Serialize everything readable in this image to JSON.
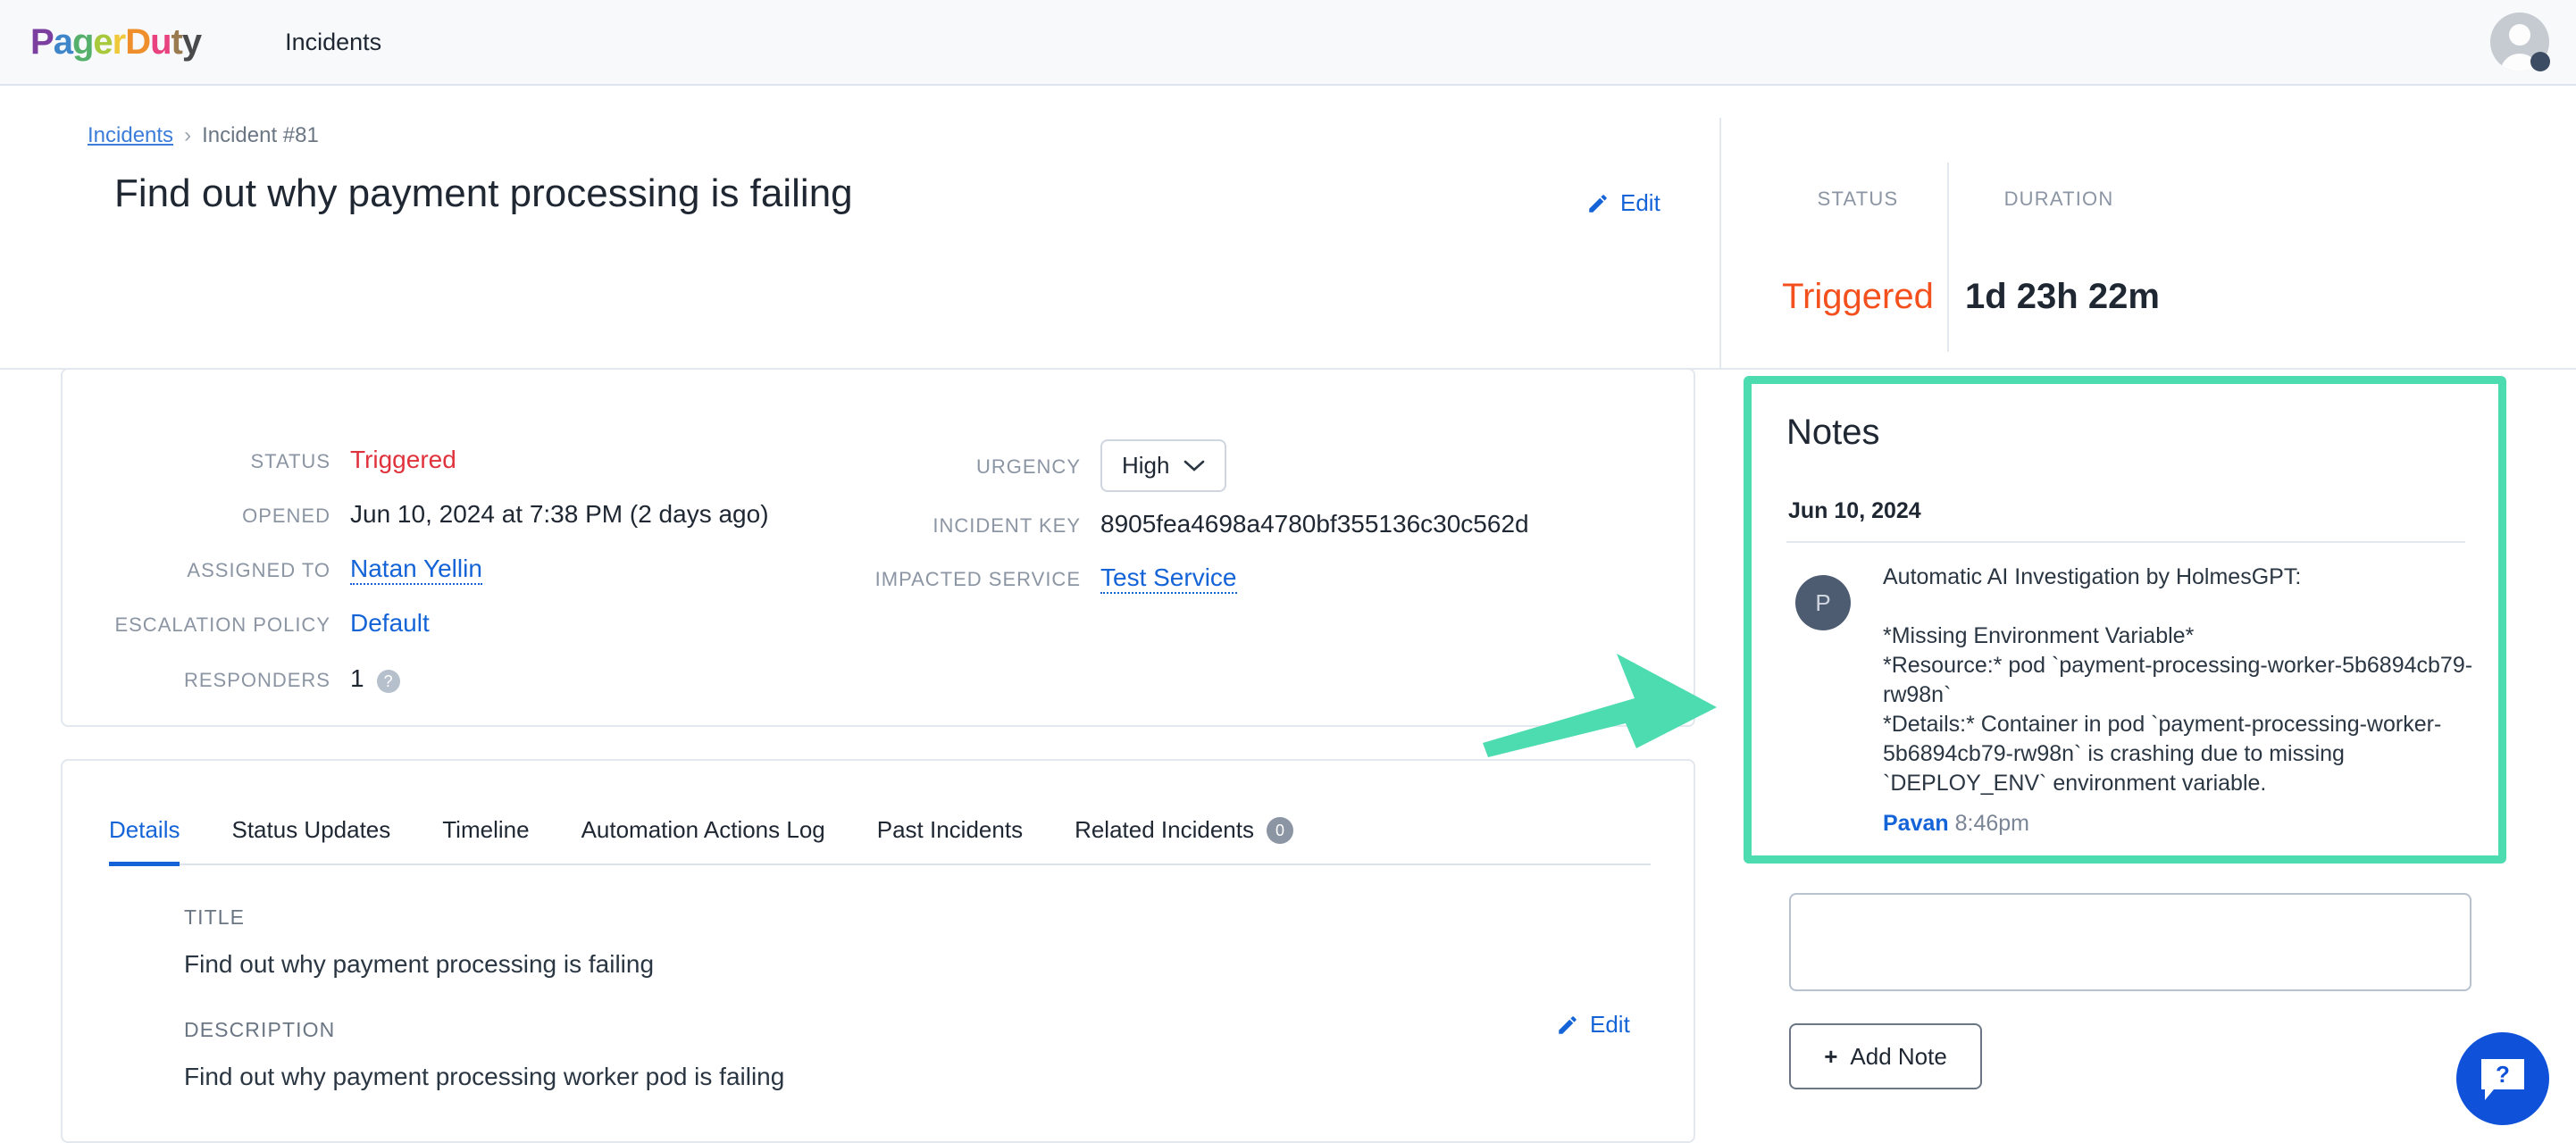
{
  "nav": {
    "brand": [
      {
        "ch": "P",
        "color": "#7b3fa0"
      },
      {
        "ch": "a",
        "color": "#3e86c9"
      },
      {
        "ch": "g",
        "color": "#54b06a"
      },
      {
        "ch": "e",
        "color": "#a8c93c"
      },
      {
        "ch": "r",
        "color": "#efc93a"
      },
      {
        "ch": "D",
        "color": "#ef8f2c"
      },
      {
        "ch": "u",
        "color": "#e8437e"
      },
      {
        "ch": "t",
        "color": "#9a7b4f"
      },
      {
        "ch": "y",
        "color": "#4a4a4a"
      }
    ],
    "brand_text": "PagerDuty",
    "incidents_link": "Incidents",
    "avatar_name": "user-avatar"
  },
  "breadcrumb": {
    "root": "Incidents",
    "separator": "›",
    "current": "Incident #81"
  },
  "header": {
    "title": "Find out why payment processing is failing",
    "edit_label": "Edit",
    "status_label": "STATUS",
    "status_value": "Triggered",
    "duration_label": "DURATION",
    "duration_value": "1d 23h 22m"
  },
  "details_card": {
    "status_label": "STATUS",
    "status_value": "Triggered",
    "opened_label": "OPENED",
    "opened_value": "Jun 10, 2024 at 7:38 PM (2 days ago)",
    "assigned_label": "ASSIGNED TO",
    "assigned_value": "Natan Yellin",
    "escalation_label": "ESCALATION POLICY",
    "escalation_value": "Default",
    "responders_label": "RESPONDERS",
    "responders_value": "1",
    "responders_help": "?",
    "urgency_label": "URGENCY",
    "urgency_value": "High",
    "incident_key_label": "INCIDENT KEY",
    "incident_key_value": "8905fea4698a4780bf355136c30c562d",
    "impacted_service_label": "IMPACTED SERVICE",
    "impacted_service_value": "Test Service"
  },
  "tabs": [
    {
      "label": "Details",
      "active": true,
      "badge": null
    },
    {
      "label": "Status Updates",
      "active": false,
      "badge": null
    },
    {
      "label": "Timeline",
      "active": false,
      "badge": null
    },
    {
      "label": "Automation Actions Log",
      "active": false,
      "badge": null
    },
    {
      "label": "Past Incidents",
      "active": false,
      "badge": null
    },
    {
      "label": "Related Incidents",
      "active": false,
      "badge": "0"
    }
  ],
  "details_tab": {
    "title_label": "TITLE",
    "title_value": "Find out why payment processing is failing",
    "description_label": "DESCRIPTION",
    "description_value": "Find out why payment processing worker pod is failing",
    "edit_label": "Edit"
  },
  "notes": {
    "heading": "Notes",
    "date": "Jun 10, 2024",
    "avatar_initial": "P",
    "entry_heading": "Automatic AI Investigation by HolmesGPT:",
    "entry_body": "*Missing Environment Variable*\n*Resource:* pod `payment-processing-worker-5b6894cb79-rw98n`\n*Details:* Container in pod `payment-processing-worker-5b6894cb79-rw98n` is crashing due to missing `DEPLOY_ENV` environment variable.",
    "author": "Pavan",
    "time": "8:46pm",
    "textarea_value": "",
    "textarea_placeholder": "",
    "add_note_label": "Add Note",
    "add_note_plus": "+"
  },
  "help_fab": {
    "icon": "question-chat-icon",
    "symbol": "?"
  },
  "annotation": {
    "type": "arrow",
    "color": "#4ddbb0",
    "points_to": "notes-panel"
  },
  "colors": {
    "accent_blue": "#1464d8",
    "status_orange": "#f4501e",
    "status_red": "#e0323c",
    "highlight_green": "#4ddbb0",
    "nav_bg": "#f7f9fb"
  }
}
